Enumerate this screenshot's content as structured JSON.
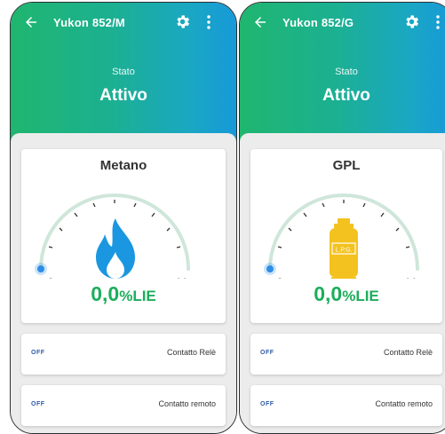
{
  "phones": [
    {
      "title": "Yukon 852/M",
      "status_label": "Stato",
      "status_value": "Attivo",
      "gas_name": "Metano",
      "gauge": {
        "min": "0",
        "max": "14",
        "level": 0
      },
      "reading_value": "0,0",
      "reading_unit": "%LIE",
      "rows": [
        {
          "state": "OFF",
          "label": "Contatto Relè"
        },
        {
          "state": "OFF",
          "label": "Contatto remoto"
        }
      ],
      "icon": "flame-icon"
    },
    {
      "title": "Yukon 852/G",
      "status_label": "Stato",
      "status_value": "Attivo",
      "gas_name": "GPL",
      "gauge": {
        "min": "0",
        "max": "14",
        "level": 0
      },
      "reading_value": "0,0",
      "reading_unit": "%LIE",
      "cylinder_text": "L.P.G.",
      "rows": [
        {
          "state": "OFF",
          "label": "Contatto Relè"
        },
        {
          "state": "OFF",
          "label": "Contatto remoto"
        }
      ],
      "icon": "gas-cylinder-icon"
    }
  ],
  "colors": {
    "accent_green": "#1cae5c",
    "gauge_track": "#cfe6da",
    "gauge_dot": "#2d8ee6",
    "flame": "#1a97e0",
    "cylinder": "#f4c21f",
    "off_text": "#2f5aa8"
  }
}
